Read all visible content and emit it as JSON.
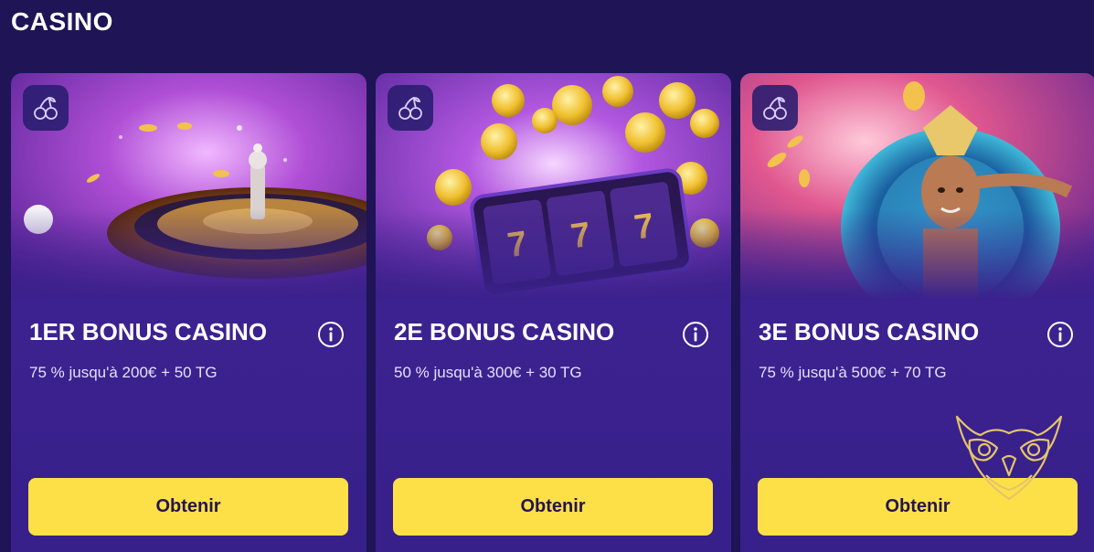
{
  "section": {
    "title": "CASINO"
  },
  "colors": {
    "page_background": "#1e1456",
    "card_background": "#3a218c",
    "button": "#fde047",
    "button_text": "#23154f",
    "logo_gold": "#e5c56a"
  },
  "cards": [
    {
      "title": "1ER BONUS CASINO",
      "description": "75 % jusqu'à 200€ + 50 TG",
      "button_label": "Obtenir",
      "image_theme": "roulette-wheel",
      "category_icon": "cherries-icon",
      "info_icon": "info-icon"
    },
    {
      "title": "2E BONUS CASINO",
      "description": "50 % jusqu'à 300€ + 30 TG",
      "button_label": "Obtenir",
      "image_theme": "slot-machine-777",
      "category_icon": "cherries-icon",
      "info_icon": "info-icon"
    },
    {
      "title": "3E BONUS CASINO",
      "description": "75 % jusqu'à 500€ + 70 TG",
      "button_label": "Obtenir",
      "image_theme": "carnival-dancer",
      "category_icon": "cherries-icon",
      "info_icon": "info-icon"
    }
  ],
  "watermark": {
    "icon": "owl-logo-icon"
  }
}
